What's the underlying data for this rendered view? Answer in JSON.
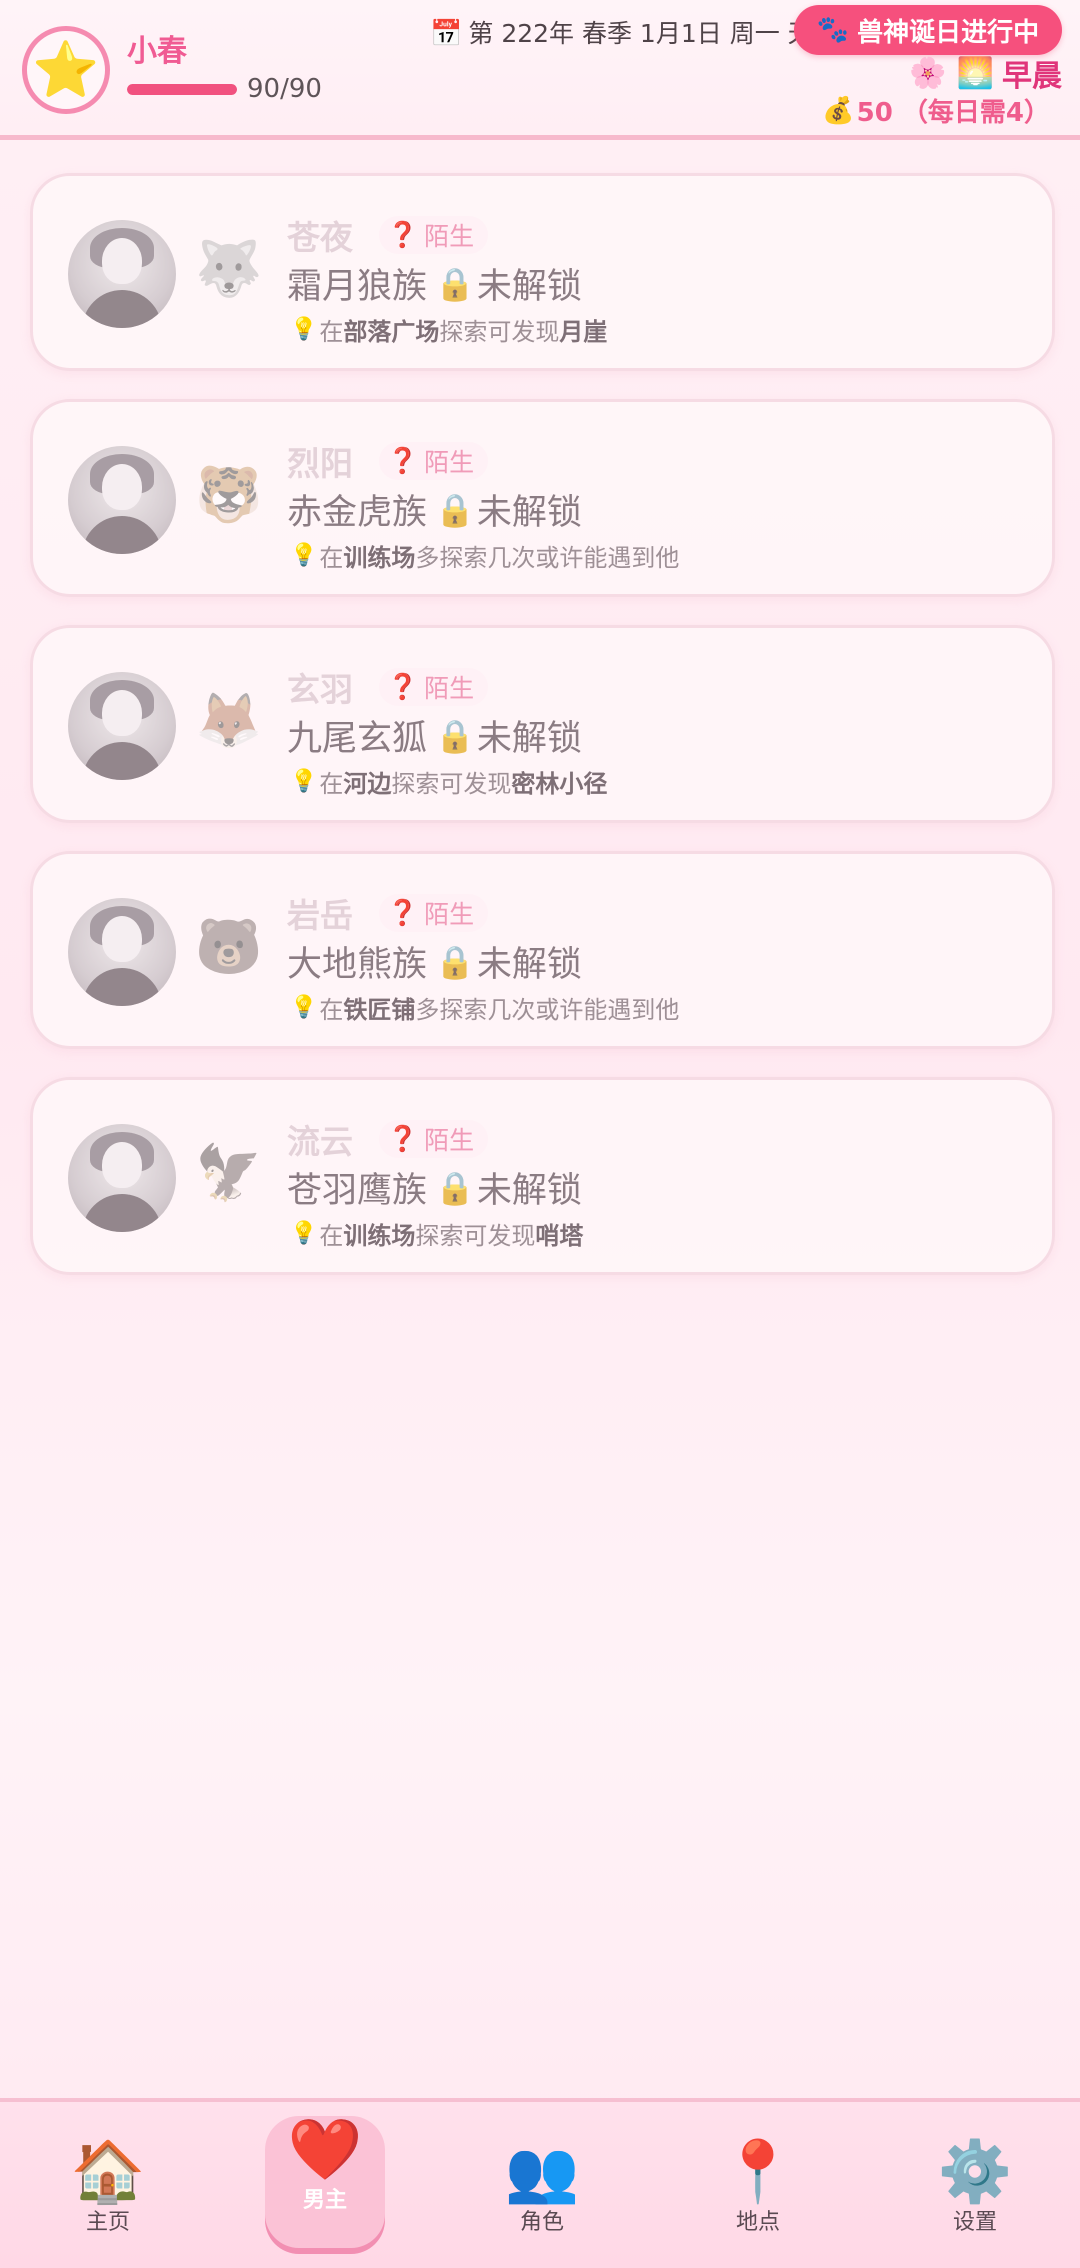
{
  "header": {
    "avatar_emoji": "⭐",
    "player_name": "小春",
    "hp_text": "90/90",
    "hp_fraction": 1.0,
    "date_icon": "📅",
    "date_text": "第 222年 春季 1月1日 周一 天",
    "event_icon": "🐾",
    "event_label": "兽神诞日进行中",
    "season_icon": "🌸",
    "time_icon": "🌅",
    "time_label": "早晨",
    "coin_icon": "💰",
    "coin_text": "50 （每日需4）",
    "accent_color": "#f6507d"
  },
  "characters": [
    {
      "name": "苍夜",
      "relation_icon": "❓",
      "relation": "陌生",
      "tribe_icon": "🐺",
      "tribe": "霜月狼族",
      "lock_icon": "🔒",
      "status": "未解锁",
      "hint_icon": "💡",
      "hint_pre": "在",
      "hint_place": "部落广场",
      "hint_mid": "探索可发现",
      "hint_target": "月崖"
    },
    {
      "name": "烈阳",
      "relation_icon": "❓",
      "relation": "陌生",
      "tribe_icon": "🐯",
      "tribe": "赤金虎族",
      "lock_icon": "🔒",
      "status": "未解锁",
      "hint_icon": "💡",
      "hint_pre": "在",
      "hint_place": "训练场",
      "hint_mid": "多探索几次或许能遇到他",
      "hint_target": ""
    },
    {
      "name": "玄羽",
      "relation_icon": "❓",
      "relation": "陌生",
      "tribe_icon": "🦊",
      "tribe": "九尾玄狐",
      "lock_icon": "🔒",
      "status": "未解锁",
      "hint_icon": "💡",
      "hint_pre": "在",
      "hint_place": "河边",
      "hint_mid": "探索可发现",
      "hint_target": "密林小径"
    },
    {
      "name": "岩岳",
      "relation_icon": "❓",
      "relation": "陌生",
      "tribe_icon": "🐻",
      "tribe": "大地熊族",
      "lock_icon": "🔒",
      "status": "未解锁",
      "hint_icon": "💡",
      "hint_pre": "在",
      "hint_place": "铁匠铺",
      "hint_mid": "多探索几次或许能遇到他",
      "hint_target": ""
    },
    {
      "name": "流云",
      "relation_icon": "❓",
      "relation": "陌生",
      "tribe_icon": "🦅",
      "tribe": "苍羽鹰族",
      "lock_icon": "🔒",
      "status": "未解锁",
      "hint_icon": "💡",
      "hint_pre": "在",
      "hint_place": "训练场",
      "hint_mid": "探索可发现",
      "hint_target": "哨塔"
    }
  ],
  "nav": [
    {
      "icon": "🏠",
      "label": "主页",
      "active": false
    },
    {
      "icon": "❤️",
      "label": "男主",
      "active": true
    },
    {
      "icon": "👥",
      "label": "角色",
      "active": false
    },
    {
      "icon": "📍",
      "label": "地点",
      "active": false
    },
    {
      "icon": "⚙️",
      "label": "设置",
      "active": false
    }
  ]
}
